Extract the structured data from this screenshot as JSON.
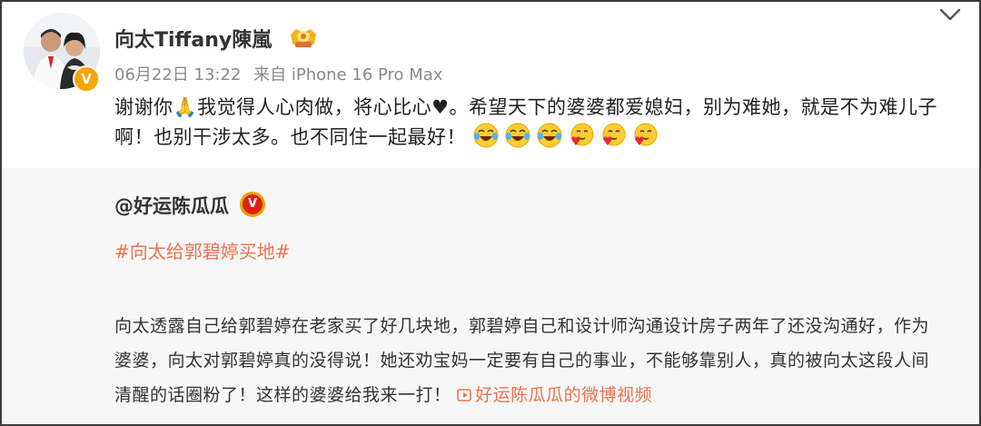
{
  "post": {
    "username": "向太Tiffany陳嵐",
    "date": "06月22日 13:22",
    "source": "来自 iPhone 16 Pro Max",
    "text": "谢谢你🙏我觉得人心肉做，将心比心♥。希望天下的婆婆都爱媳妇，别为难她，就是不为难儿子啊！也别干涉太多。也不同住一起最好！",
    "emojis": [
      "laugh-cry",
      "laugh-cry",
      "laugh-cry",
      "heart-face",
      "heart-face",
      "heart-face"
    ],
    "verified_badge": "V"
  },
  "repost": {
    "username": "@好运陈瓜瓜",
    "badge": "V",
    "hashtag": "#向太给郭碧婷买地#",
    "text": "向太透露自己给郭碧婷在老家买了好几块地，郭碧婷自己和设计师沟通设计房子两年了还没沟通好，作为婆婆，向太对郭碧婷真的没得说！她还劝宝妈一定要有自己的事业，不能够靠别人，真的被向太这段人间清醒的话圈粉了！这样的婆婆给我来一打！",
    "video_link": "好运陈瓜瓜的微博视频"
  },
  "colors": {
    "accent": "#eb7350",
    "meta_gray": "#8a8a8a",
    "repost_bg": "#f7f7f7",
    "verified_gold": "#f7a400"
  }
}
